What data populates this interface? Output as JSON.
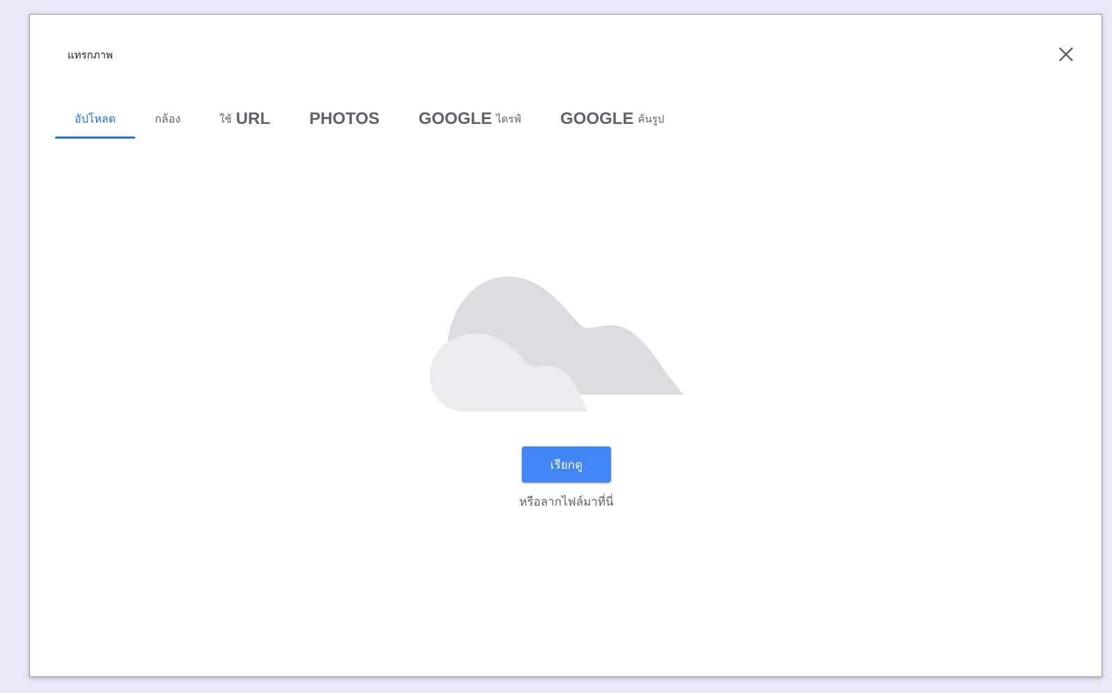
{
  "dialog": {
    "title": "แทรกภาพ",
    "close_icon": "close-icon"
  },
  "tabs": [
    {
      "label": "อัปโหลด",
      "suffix": "",
      "active": true
    },
    {
      "label": "กล้อง",
      "suffix": "",
      "active": false
    },
    {
      "label": "ใช้",
      "suffix": "URL",
      "active": false
    },
    {
      "label": "PHOTOS",
      "suffix": "",
      "active": false
    },
    {
      "label": "GOOGLE",
      "suffix": "ไดรฟ์",
      "active": false
    },
    {
      "label": "GOOGLE",
      "suffix": "ค้นรูป",
      "active": false
    }
  ],
  "upload": {
    "illustration": "cloud-illustration",
    "browse_label": "เรียกดู",
    "drop_hint": "หรือลากไฟล์มาที่นี่"
  },
  "colors": {
    "accent": "#1a73e8",
    "button": "#4285f4",
    "cloud_back": "#dadce0",
    "cloud_front": "#ebecee"
  }
}
